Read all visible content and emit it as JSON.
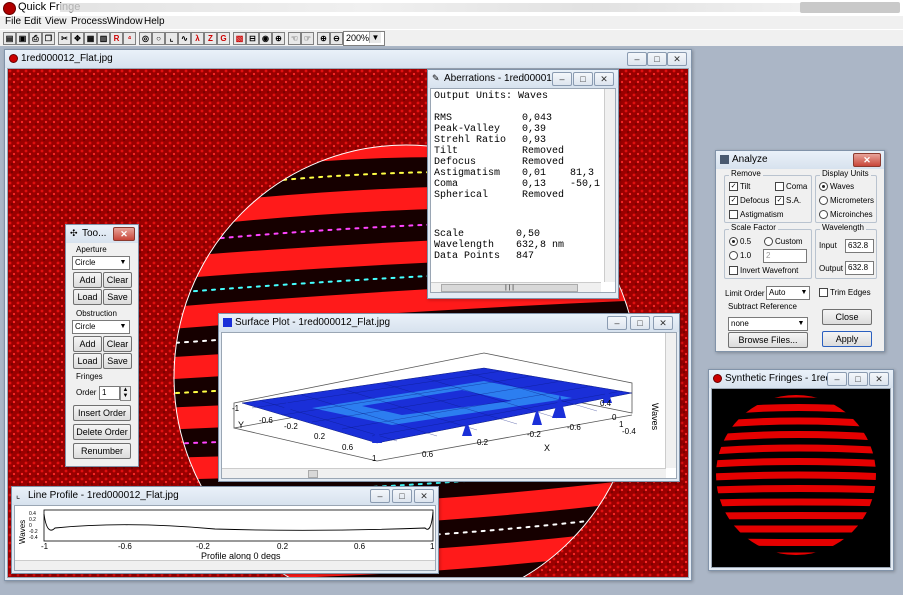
{
  "app": {
    "title": "Quick Fringe"
  },
  "menu": [
    "File",
    "Edit",
    "View",
    "Process",
    "Window",
    "Help"
  ],
  "toolbar": {
    "zoom": "200%",
    "buttons": [
      "save",
      "print",
      "copy",
      "grid",
      "refresh",
      "red-r",
      "fringe",
      "aperture",
      "circle",
      "chart",
      "zernike",
      "spectrum",
      "lambda",
      "Z",
      "G",
      "sphere",
      "filter",
      "zoom-in",
      "zoom-out"
    ]
  },
  "main_window": {
    "title": "1red000012_Flat.jpg"
  },
  "aberrations": {
    "title": "Aberrations - 1red000012...",
    "units": "Output Units: Waves",
    "rows": [
      {
        "name": "RMS",
        "v1": "0,043",
        "v2": ""
      },
      {
        "name": "Peak-Valley",
        "v1": "0,39",
        "v2": ""
      },
      {
        "name": "Strehl Ratio",
        "v1": "0,93",
        "v2": ""
      },
      {
        "name": "Tilt",
        "v1": "Removed",
        "v2": ""
      },
      {
        "name": "Defocus",
        "v1": "Removed",
        "v2": ""
      },
      {
        "name": "Astigmatism",
        "v1": "0,01",
        "v2": "81,3"
      },
      {
        "name": "Coma",
        "v1": "0,13",
        "v2": "-50,1"
      },
      {
        "name": "Spherical",
        "v1": "Removed",
        "v2": ""
      }
    ],
    "rows2": [
      {
        "name": "Scale",
        "v1": "0,50"
      },
      {
        "name": "Wavelength",
        "v1": "632,8 nm"
      },
      {
        "name": "Data Points",
        "v1": "847"
      }
    ],
    "scroll_glyph": "|||"
  },
  "tools": {
    "title": "Too...",
    "aperture": {
      "label": "Aperture",
      "value": "Circle",
      "add": "Add",
      "clear": "Clear",
      "load": "Load",
      "save": "Save"
    },
    "obstruction": {
      "label": "Obstruction",
      "value": "Circle",
      "add": "Add",
      "clear": "Clear",
      "load": "Load",
      "save": "Save"
    },
    "fringes": {
      "label": "Fringes",
      "order_label": "Order",
      "order_value": "1",
      "insert": "Insert Order",
      "delete": "Delete Order",
      "renumber": "Renumber"
    }
  },
  "surface": {
    "title": "Surface Plot - 1red000012_Flat.jpg",
    "z_label": "Waves",
    "x_label": "X",
    "y_label": "Y",
    "z_ticks": [
      "0.4",
      "0",
      "-0.4"
    ],
    "x_ticks": [
      "0.6",
      "0.2",
      "-0.2",
      "-0.6",
      "1"
    ],
    "y_ticks": [
      "-1",
      "-0.6",
      "-0.2",
      "0.2",
      "0.6",
      "1"
    ]
  },
  "line_profile": {
    "title": "Line Profile - 1red000012_Flat.jpg",
    "ylabel": "Waves",
    "yticks": [
      "0.4",
      "0.2",
      "0",
      "-0.2",
      "-0.4"
    ],
    "xticks": [
      "-1",
      "-0.6",
      "-0.2",
      "0.2",
      "0.6",
      "1"
    ],
    "xlabel": "Profile along 0 degs"
  },
  "analyze": {
    "title": "Analyze",
    "remove": {
      "label": "Remove",
      "tilt": "Tilt",
      "coma": "Coma",
      "defocus": "Defocus",
      "sa": "S.A.",
      "astig": "Astigmatism"
    },
    "display_units": {
      "label": "Display Units",
      "waves": "Waves",
      "micrometers": "Micrometers",
      "microinches": "Microinches"
    },
    "scale_factor": {
      "label": "Scale Factor",
      "r05": "0.5",
      "custom": "Custom",
      "r10": "1.0",
      "custom_value": "2",
      "invert": "Invert Wavefront"
    },
    "wavelength": {
      "label": "Wavelength",
      "input_label": "Input",
      "input": "632.8",
      "output_label": "Output",
      "output": "632.8"
    },
    "limit_order_label": "Limit Order",
    "limit_order": "Auto",
    "trim_edges": "Trim Edges",
    "subtract_ref": {
      "label": "Subtract Reference",
      "value": "none",
      "browse": "Browse Files..."
    },
    "close": "Close",
    "apply": "Apply"
  },
  "synthetic": {
    "title": "Synthetic Fringes - 1red..."
  },
  "colors": {
    "fringe_red": "#d00000",
    "window_bg": "#e3ebf4",
    "workspace": "#abb6c6",
    "surface_blue": "#1a2fd8"
  }
}
